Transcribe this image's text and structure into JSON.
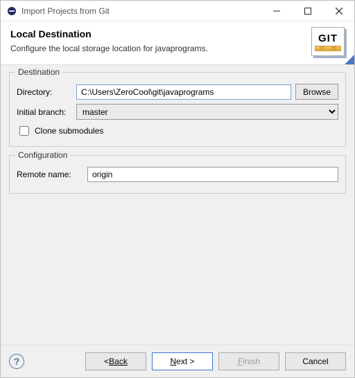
{
  "window": {
    "title": "Import Projects from Git"
  },
  "header": {
    "title": "Local Destination",
    "description": "Configure the local storage location for javaprograms.",
    "logo_text": "GIT"
  },
  "destination": {
    "legend": "Destination",
    "directory_label": "Directory:",
    "directory_value": "C:\\Users\\ZeroCool\\git\\javaprograms",
    "browse_label": "Browse",
    "branch_label": "Initial branch:",
    "branch_value": "master",
    "clone_sub_label": "Clone submodules",
    "clone_sub_checked": false
  },
  "configuration": {
    "legend": "Configuration",
    "remote_label": "Remote name:",
    "remote_value": "origin"
  },
  "footer": {
    "help": "?",
    "back": "Back",
    "next": "Next >",
    "finish": "Finish",
    "cancel": "Cancel"
  }
}
